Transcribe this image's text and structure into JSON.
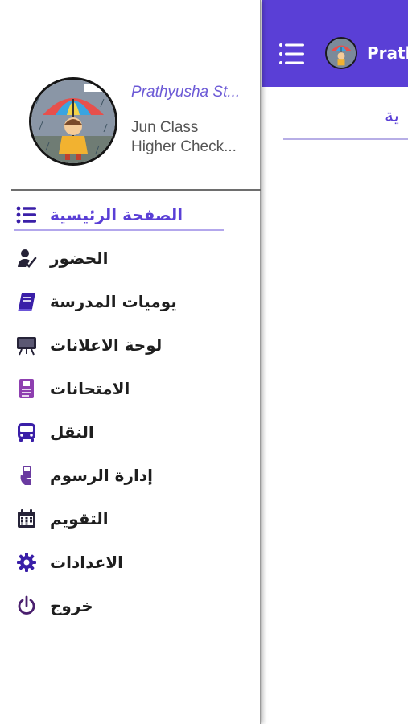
{
  "topbar": {
    "student_name_short": "Prath",
    "background_tab": "ية"
  },
  "profile": {
    "name": "Prathyusha St...",
    "class": "Jun Class",
    "school": "Higher Check..."
  },
  "menu": [
    {
      "label": "الصفحة الرئيسية",
      "icon": "list-icon",
      "active": true
    },
    {
      "label": "الحضور",
      "icon": "user-check-icon",
      "active": false
    },
    {
      "label": "يوميات المدرسة",
      "icon": "book-icon",
      "active": false
    },
    {
      "label": "لوحة الاعلانات",
      "icon": "noticeboard-icon",
      "active": false
    },
    {
      "label": "الامتحانات",
      "icon": "exam-paper-icon",
      "active": false
    },
    {
      "label": "النقل",
      "icon": "bus-icon",
      "active": false
    },
    {
      "label": "إدارة الرسوم",
      "icon": "fee-hand-icon",
      "active": false
    },
    {
      "label": "التقويم",
      "icon": "calendar-icon",
      "active": false
    },
    {
      "label": "الاعدادات",
      "icon": "gear-icon",
      "active": false
    },
    {
      "label": "خروج",
      "icon": "power-icon",
      "active": false
    }
  ],
  "colors": {
    "accent": "#5a3fd6",
    "icon_purple": "#3a1fa8",
    "icon_dark": "#262338",
    "exam_icon": "#8e3fb0",
    "fee_icon": "#6a3aa0"
  }
}
